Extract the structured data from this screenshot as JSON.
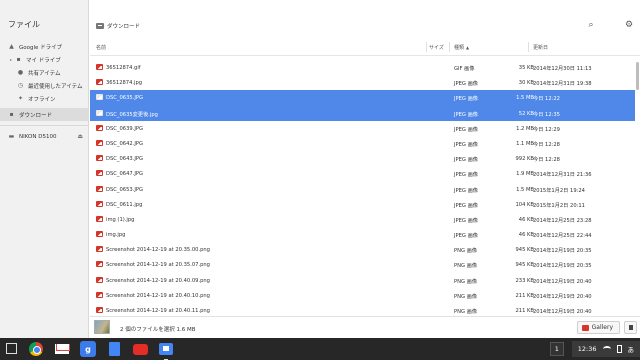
{
  "app": {
    "title": "ファイル"
  },
  "sidebar": {
    "items": [
      {
        "label": "Google ドライブ",
        "icon": "drive-icon"
      },
      {
        "label": "マイ ドライブ",
        "icon": "drive-folder-icon"
      },
      {
        "label": "共有アイテム",
        "icon": "people-icon"
      },
      {
        "label": "最近使用したアイテム",
        "icon": "clock-icon"
      },
      {
        "label": "オフライン",
        "icon": "pin-icon"
      },
      {
        "label": "ダウンロード",
        "icon": "download-icon"
      },
      {
        "label": "NIKON D5100",
        "icon": "device-icon"
      }
    ]
  },
  "breadcrumb": {
    "label": "ダウンロード"
  },
  "columns": {
    "name": "名前",
    "size": "サイズ",
    "type": "種類",
    "sort": "▲",
    "date": "更新日"
  },
  "files": [
    {
      "name": "36512874.gif",
      "size": "35 KB",
      "type": "GIF 画像",
      "date": "2014年12月30日 11:13",
      "selected": false
    },
    {
      "name": "36512874.jpg",
      "size": "30 KB",
      "type": "JPEG 画像",
      "date": "2014年12月31日 19:38",
      "selected": false
    },
    {
      "name": "DSC_0635.JPG",
      "size": "1.5 MB",
      "type": "JPEG 画像",
      "date": "今日 12:22",
      "selected": true
    },
    {
      "name": "DSC_0635変更後.jpg",
      "size": "52 KB",
      "type": "JPEG 画像",
      "date": "今日 12:35",
      "selected": true
    },
    {
      "name": "DSC_0639.JPG",
      "size": "1.2 MB",
      "type": "JPEG 画像",
      "date": "今日 12:29",
      "selected": false
    },
    {
      "name": "DSC_0642.JPG",
      "size": "1.1 MB",
      "type": "JPEG 画像",
      "date": "今日 12:28",
      "selected": false
    },
    {
      "name": "DSC_0643.JPG",
      "size": "992 KB",
      "type": "JPEG 画像",
      "date": "今日 12:28",
      "selected": false
    },
    {
      "name": "DSC_0647.JPG",
      "size": "1.9 MB",
      "type": "JPEG 画像",
      "date": "2014年12月31日 21:36",
      "selected": false
    },
    {
      "name": "DSC_0653.JPG",
      "size": "1.5 MB",
      "type": "JPEG 画像",
      "date": "2015年1月2日 19:24",
      "selected": false
    },
    {
      "name": "DSC_0611.jpg",
      "size": "104 KB",
      "type": "JPEG 画像",
      "date": "2015年1月2日 20:11",
      "selected": false
    },
    {
      "name": "img (1).jpg",
      "size": "46 KB",
      "type": "JPEG 画像",
      "date": "2014年12月25日 23:28",
      "selected": false
    },
    {
      "name": "img.jpg",
      "size": "46 KB",
      "type": "JPEG 画像",
      "date": "2014年12月25日 22:44",
      "selected": false
    },
    {
      "name": "Screenshot 2014-12-19 at 20.35.00.png",
      "size": "945 KB",
      "type": "PNG 画像",
      "date": "2014年12月19日 20:35",
      "selected": false
    },
    {
      "name": "Screenshot 2014-12-19 at 20.35.07.png",
      "size": "945 KB",
      "type": "PNG 画像",
      "date": "2014年12月19日 20:35",
      "selected": false
    },
    {
      "name": "Screenshot 2014-12-19 at 20.40.09.png",
      "size": "233 KB",
      "type": "PNG 画像",
      "date": "2014年12月19日 20:40",
      "selected": false
    },
    {
      "name": "Screenshot 2014-12-19 at 20.40.10.png",
      "size": "211 KB",
      "type": "PNG 画像",
      "date": "2014年12月19日 20:40",
      "selected": false
    },
    {
      "name": "Screenshot 2014-12-19 at 20.40.11.png",
      "size": "211 KB",
      "type": "PNG 画像",
      "date": "2014年12月19日 20:40",
      "selected": false
    }
  ],
  "status": {
    "text": "2 個のファイルを選択 1.6 MB"
  },
  "gallery": {
    "label": "Gallery"
  },
  "shelf": {
    "apps": [
      "chrome-icon",
      "gmail-icon",
      "google-search-icon",
      "docs-icon",
      "youtube-icon",
      "files-icon"
    ],
    "notification_count": "1",
    "time": "12:36",
    "ime": "あ"
  },
  "colors": {
    "selection": "#4f88e8",
    "file_icon": "#d8352a",
    "shelf": "#272727"
  }
}
